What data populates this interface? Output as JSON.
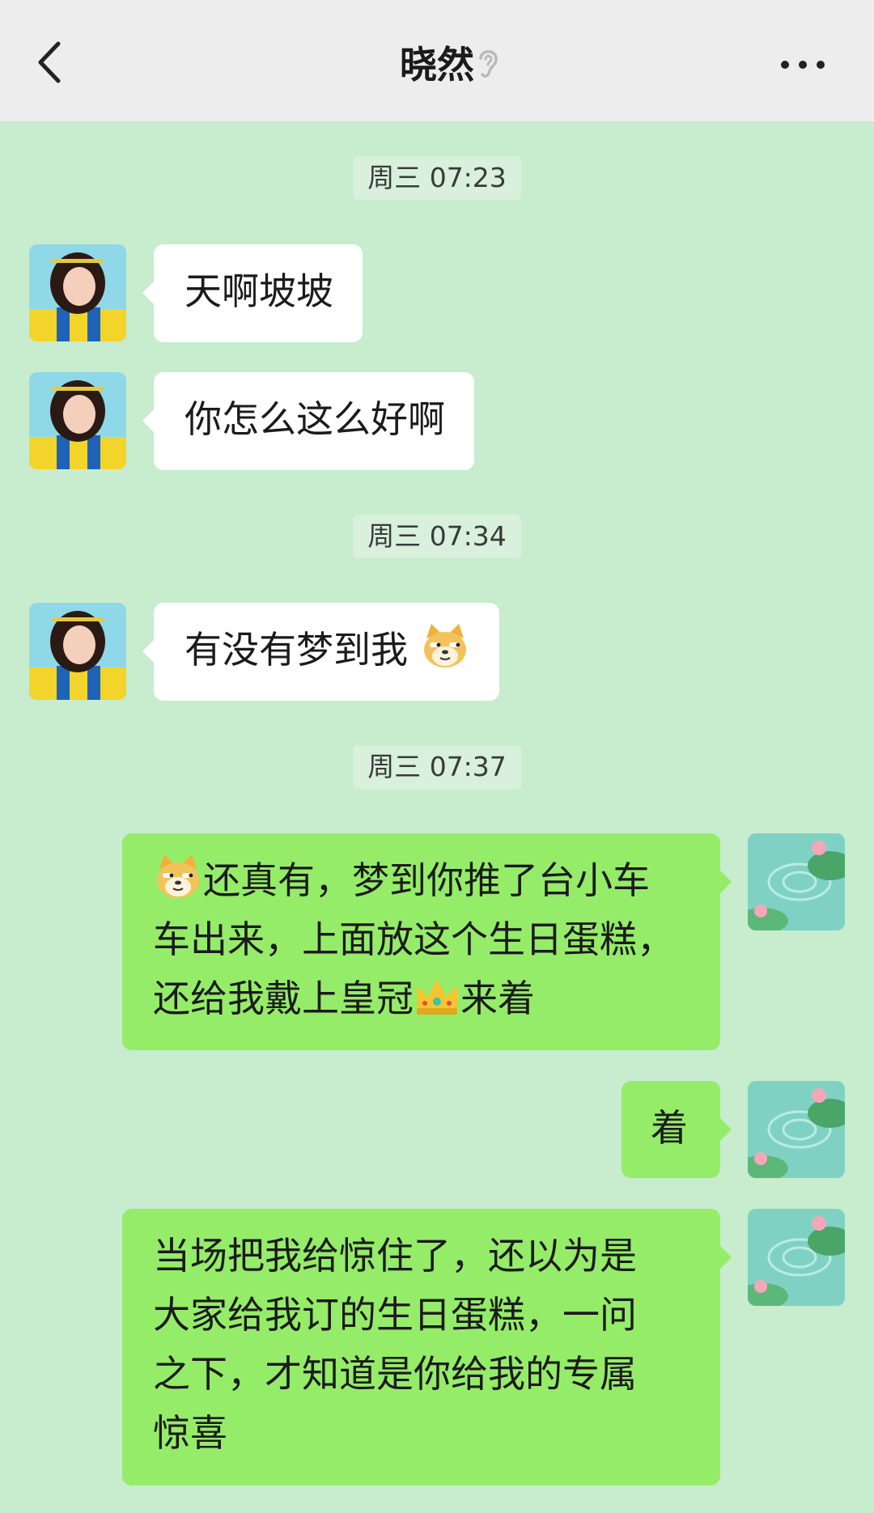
{
  "header": {
    "title": "晓然",
    "back_icon": "chevron-left-icon",
    "earpiece_icon": "ear-icon",
    "more_icon": "more-dots-icon"
  },
  "timestamps": [
    "周三 07:23",
    "周三 07:34",
    "周三 07:37"
  ],
  "messages": [
    {
      "from": "them",
      "text": "天啊坡坡"
    },
    {
      "from": "them",
      "text": "你怎么这么好啊"
    },
    {
      "from": "them",
      "text": "有没有梦到我",
      "emoji_after": "doge-emoji"
    },
    {
      "from": "me",
      "emoji_before": "doge-emoji",
      "line1": "还真有，梦到你推了台小车",
      "line2": "车出来，上面放这个生日蛋糕，",
      "line3a": "还给我戴上皇冠",
      "line3_emoji": "crown-emoji",
      "line3b": "来着"
    },
    {
      "from": "me",
      "text": "着"
    },
    {
      "from": "me",
      "line1": "当场把我给惊住了，还以为是",
      "line2": "大家给我订的生日蛋糕，一问",
      "line3": "之下，才知道是你给我的专属",
      "line4": "惊喜"
    }
  ],
  "colors": {
    "background": "#c7ecce",
    "header": "#ededed",
    "incoming_bubble": "#ffffff",
    "outgoing_bubble": "#95ec69"
  }
}
